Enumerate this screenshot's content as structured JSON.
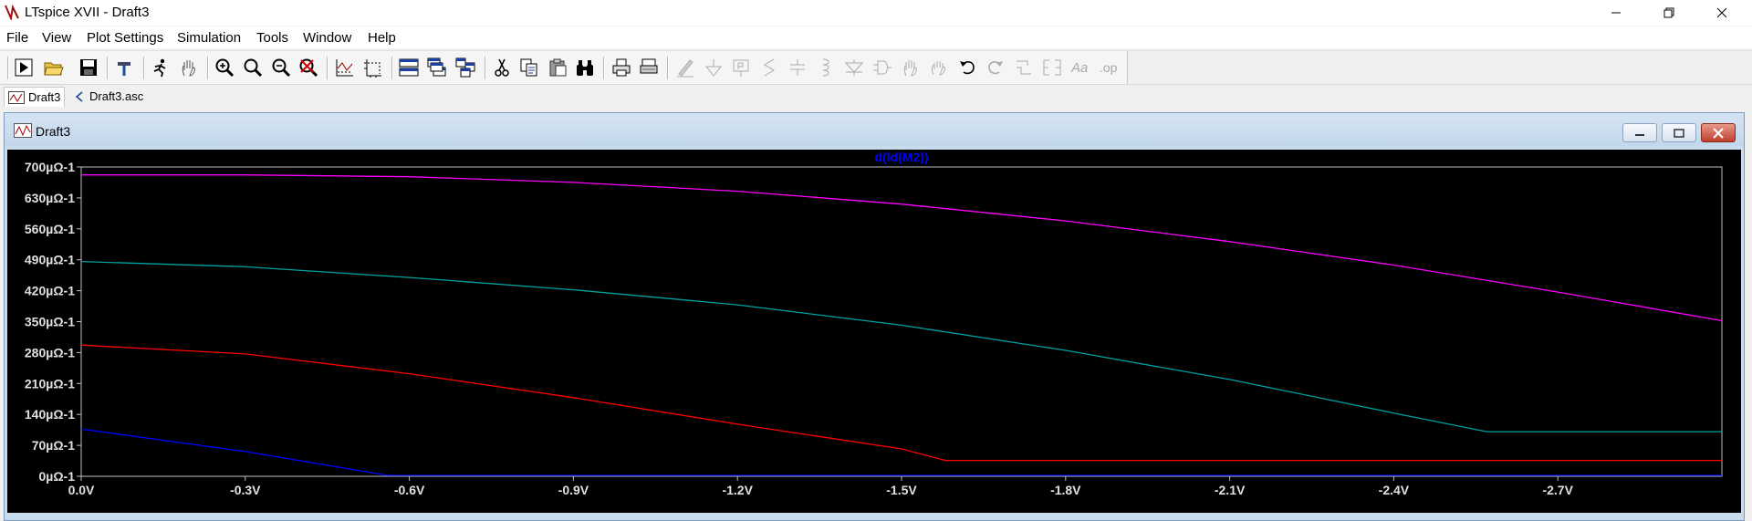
{
  "window": {
    "title": "LTspice XVII - Draft3"
  },
  "menu": [
    {
      "label": "File",
      "u": "F"
    },
    {
      "label": "View",
      "u": "V"
    },
    {
      "label": "Plot Settings",
      "u": "P"
    },
    {
      "label": "Simulation",
      "u": "S"
    },
    {
      "label": "Tools",
      "u": "T"
    },
    {
      "label": "Window",
      "u": "W"
    },
    {
      "label": "Help",
      "u": "H"
    }
  ],
  "tabs": [
    {
      "label": "Draft3"
    },
    {
      "label": "Draft3.asc"
    }
  ],
  "plot_window": {
    "title": "Draft3"
  },
  "colors": {
    "background": "#000000",
    "axes": "#c0c0c0",
    "title": "#0000ff",
    "traces": [
      "#ff00ff",
      "#00a0a0",
      "#ff0000",
      "#0000ff"
    ]
  },
  "chart_data": {
    "type": "line",
    "title": "d(Id(M2))",
    "xlabel": "",
    "ylabel": "",
    "x_ticks": [
      "0.0V",
      "-0.3V",
      "-0.6V",
      "-0.9V",
      "-1.2V",
      "-1.5V",
      "-1.8V",
      "-2.1V",
      "-2.4V",
      "-2.7V"
    ],
    "y_ticks": [
      "700µΩ-1",
      "630µΩ-1",
      "560µΩ-1",
      "490µΩ-1",
      "420µΩ-1",
      "350µΩ-1",
      "280µΩ-1",
      "210µΩ-1",
      "140µΩ-1",
      "70µΩ-1",
      "0µΩ-1"
    ],
    "xlim": [
      0,
      -3.0
    ],
    "ylim": [
      0,
      700
    ],
    "grid": false,
    "series": [
      {
        "color": "#ff00ff",
        "x": [
          0,
          -0.3,
          -0.6,
          -0.9,
          -1.2,
          -1.5,
          -1.8,
          -2.1,
          -2.4,
          -2.7,
          -3.0
        ],
        "y": [
          682,
          682,
          678,
          665,
          645,
          616,
          578,
          531,
          478,
          417,
          352
        ]
      },
      {
        "color": "#00a0a0",
        "x": [
          0,
          -0.3,
          -0.6,
          -0.9,
          -1.2,
          -1.5,
          -1.8,
          -2.1,
          -2.4,
          -2.57,
          -2.7,
          -3.0
        ],
        "y": [
          486,
          474,
          450,
          422,
          388,
          342,
          285,
          219,
          143,
          101,
          101,
          101
        ]
      },
      {
        "color": "#ff0000",
        "x": [
          0,
          -0.3,
          -0.6,
          -0.9,
          -1.2,
          -1.5,
          -1.58,
          -1.8,
          -2.1,
          -2.4,
          -2.7,
          -3.0
        ],
        "y": [
          297,
          277,
          232,
          178,
          118,
          62,
          36,
          36,
          36,
          36,
          36,
          36
        ]
      },
      {
        "color": "#0000ff",
        "x": [
          0,
          -0.3,
          -0.56,
          -0.6,
          -0.9,
          -1.2,
          -1.5,
          -1.8,
          -2.1,
          -2.4,
          -2.7,
          -3.0
        ],
        "y": [
          107,
          56,
          2,
          2,
          2,
          2,
          2,
          2,
          2,
          2,
          2,
          2
        ]
      }
    ]
  }
}
